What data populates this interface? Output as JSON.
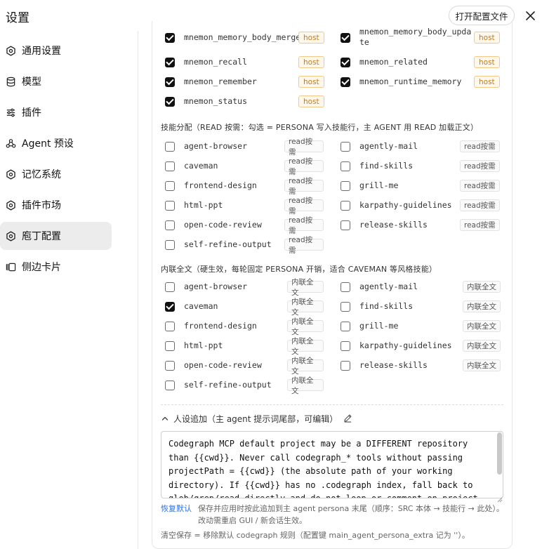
{
  "header": {
    "title": "设置",
    "open_config_label": "打开配置文件"
  },
  "sidebar": {
    "items": [
      {
        "label": "通用设置",
        "icon": "gear-icon"
      },
      {
        "label": "模型",
        "icon": "database-icon"
      },
      {
        "label": "插件",
        "icon": "sliders-icon"
      },
      {
        "label": "Agent 预设",
        "icon": "agent-icon"
      },
      {
        "label": "记忆系统",
        "icon": "gear-icon"
      },
      {
        "label": "插件市场",
        "icon": "gear-icon"
      },
      {
        "label": "庖丁配置",
        "icon": "gear-icon",
        "active": true
      },
      {
        "label": "侧边卡片",
        "icon": "cards-icon"
      }
    ]
  },
  "host_tools": {
    "tag": "host",
    "items": [
      {
        "name": "mnemon_memory_body_merge",
        "checked": true
      },
      {
        "name": "mnemon_memory_body_update",
        "checked": true
      },
      {
        "name": "mnemon_recall",
        "checked": true
      },
      {
        "name": "mnemon_related",
        "checked": true
      },
      {
        "name": "mnemon_remember",
        "checked": true
      },
      {
        "name": "mnemon_runtime_memory",
        "checked": true
      },
      {
        "name": "mnemon_status",
        "checked": true
      }
    ]
  },
  "read_section": {
    "title": "技能分配（READ 按需：勾选 = PERSONA 写入技能行，主 AGENT 用 READ 加载正文）",
    "tag": "read按需",
    "items": [
      {
        "name": "agent-browser",
        "checked": false
      },
      {
        "name": "agently-mail",
        "checked": false
      },
      {
        "name": "caveman",
        "checked": false
      },
      {
        "name": "find-skills",
        "checked": false
      },
      {
        "name": "frontend-design",
        "checked": false
      },
      {
        "name": "grill-me",
        "checked": false
      },
      {
        "name": "html-ppt",
        "checked": false
      },
      {
        "name": "karpathy-guidelines",
        "checked": false
      },
      {
        "name": "open-code-review",
        "checked": false
      },
      {
        "name": "release-skills",
        "checked": false
      },
      {
        "name": "self-refine-output",
        "checked": false
      }
    ]
  },
  "inline_section": {
    "title": "内联全文（硬生效，每轮固定 PERSONA 开销，适合 CAVEMAN 等风格技能）",
    "tag": "内联全文",
    "items": [
      {
        "name": "agent-browser",
        "checked": false
      },
      {
        "name": "agently-mail",
        "checked": false
      },
      {
        "name": "caveman",
        "checked": true
      },
      {
        "name": "find-skills",
        "checked": false
      },
      {
        "name": "frontend-design",
        "checked": false
      },
      {
        "name": "grill-me",
        "checked": false
      },
      {
        "name": "html-ppt",
        "checked": false
      },
      {
        "name": "karpathy-guidelines",
        "checked": false
      },
      {
        "name": "open-code-review",
        "checked": false
      },
      {
        "name": "release-skills",
        "checked": false
      },
      {
        "name": "self-refine-output",
        "checked": false
      }
    ]
  },
  "persona": {
    "title": "人设追加（主 agent 提示词尾部，可编辑）",
    "text": "Codegraph MCP default project may be a DIFFERENT repository than {{cwd}}. Never call codegraph_* tools without passing projectPath = {{cwd}} (the absolute path of your working directory). If {{cwd}} has no .codegraph index, fall back to glob/grep/read directly and do not loop or comment on project",
    "restore_label": "恢复默认",
    "note_primary": "保存并应用时按此追加到主 agent persona 末尾（顺序：SRC 本体 → 技能行 → 此处）。改动需重启 GUI / 新会话生效。",
    "note_secondary": "清空保存 = 移除默认 codegraph 规则（配置键 main_agent_persona_extra 记为 ''）。"
  }
}
